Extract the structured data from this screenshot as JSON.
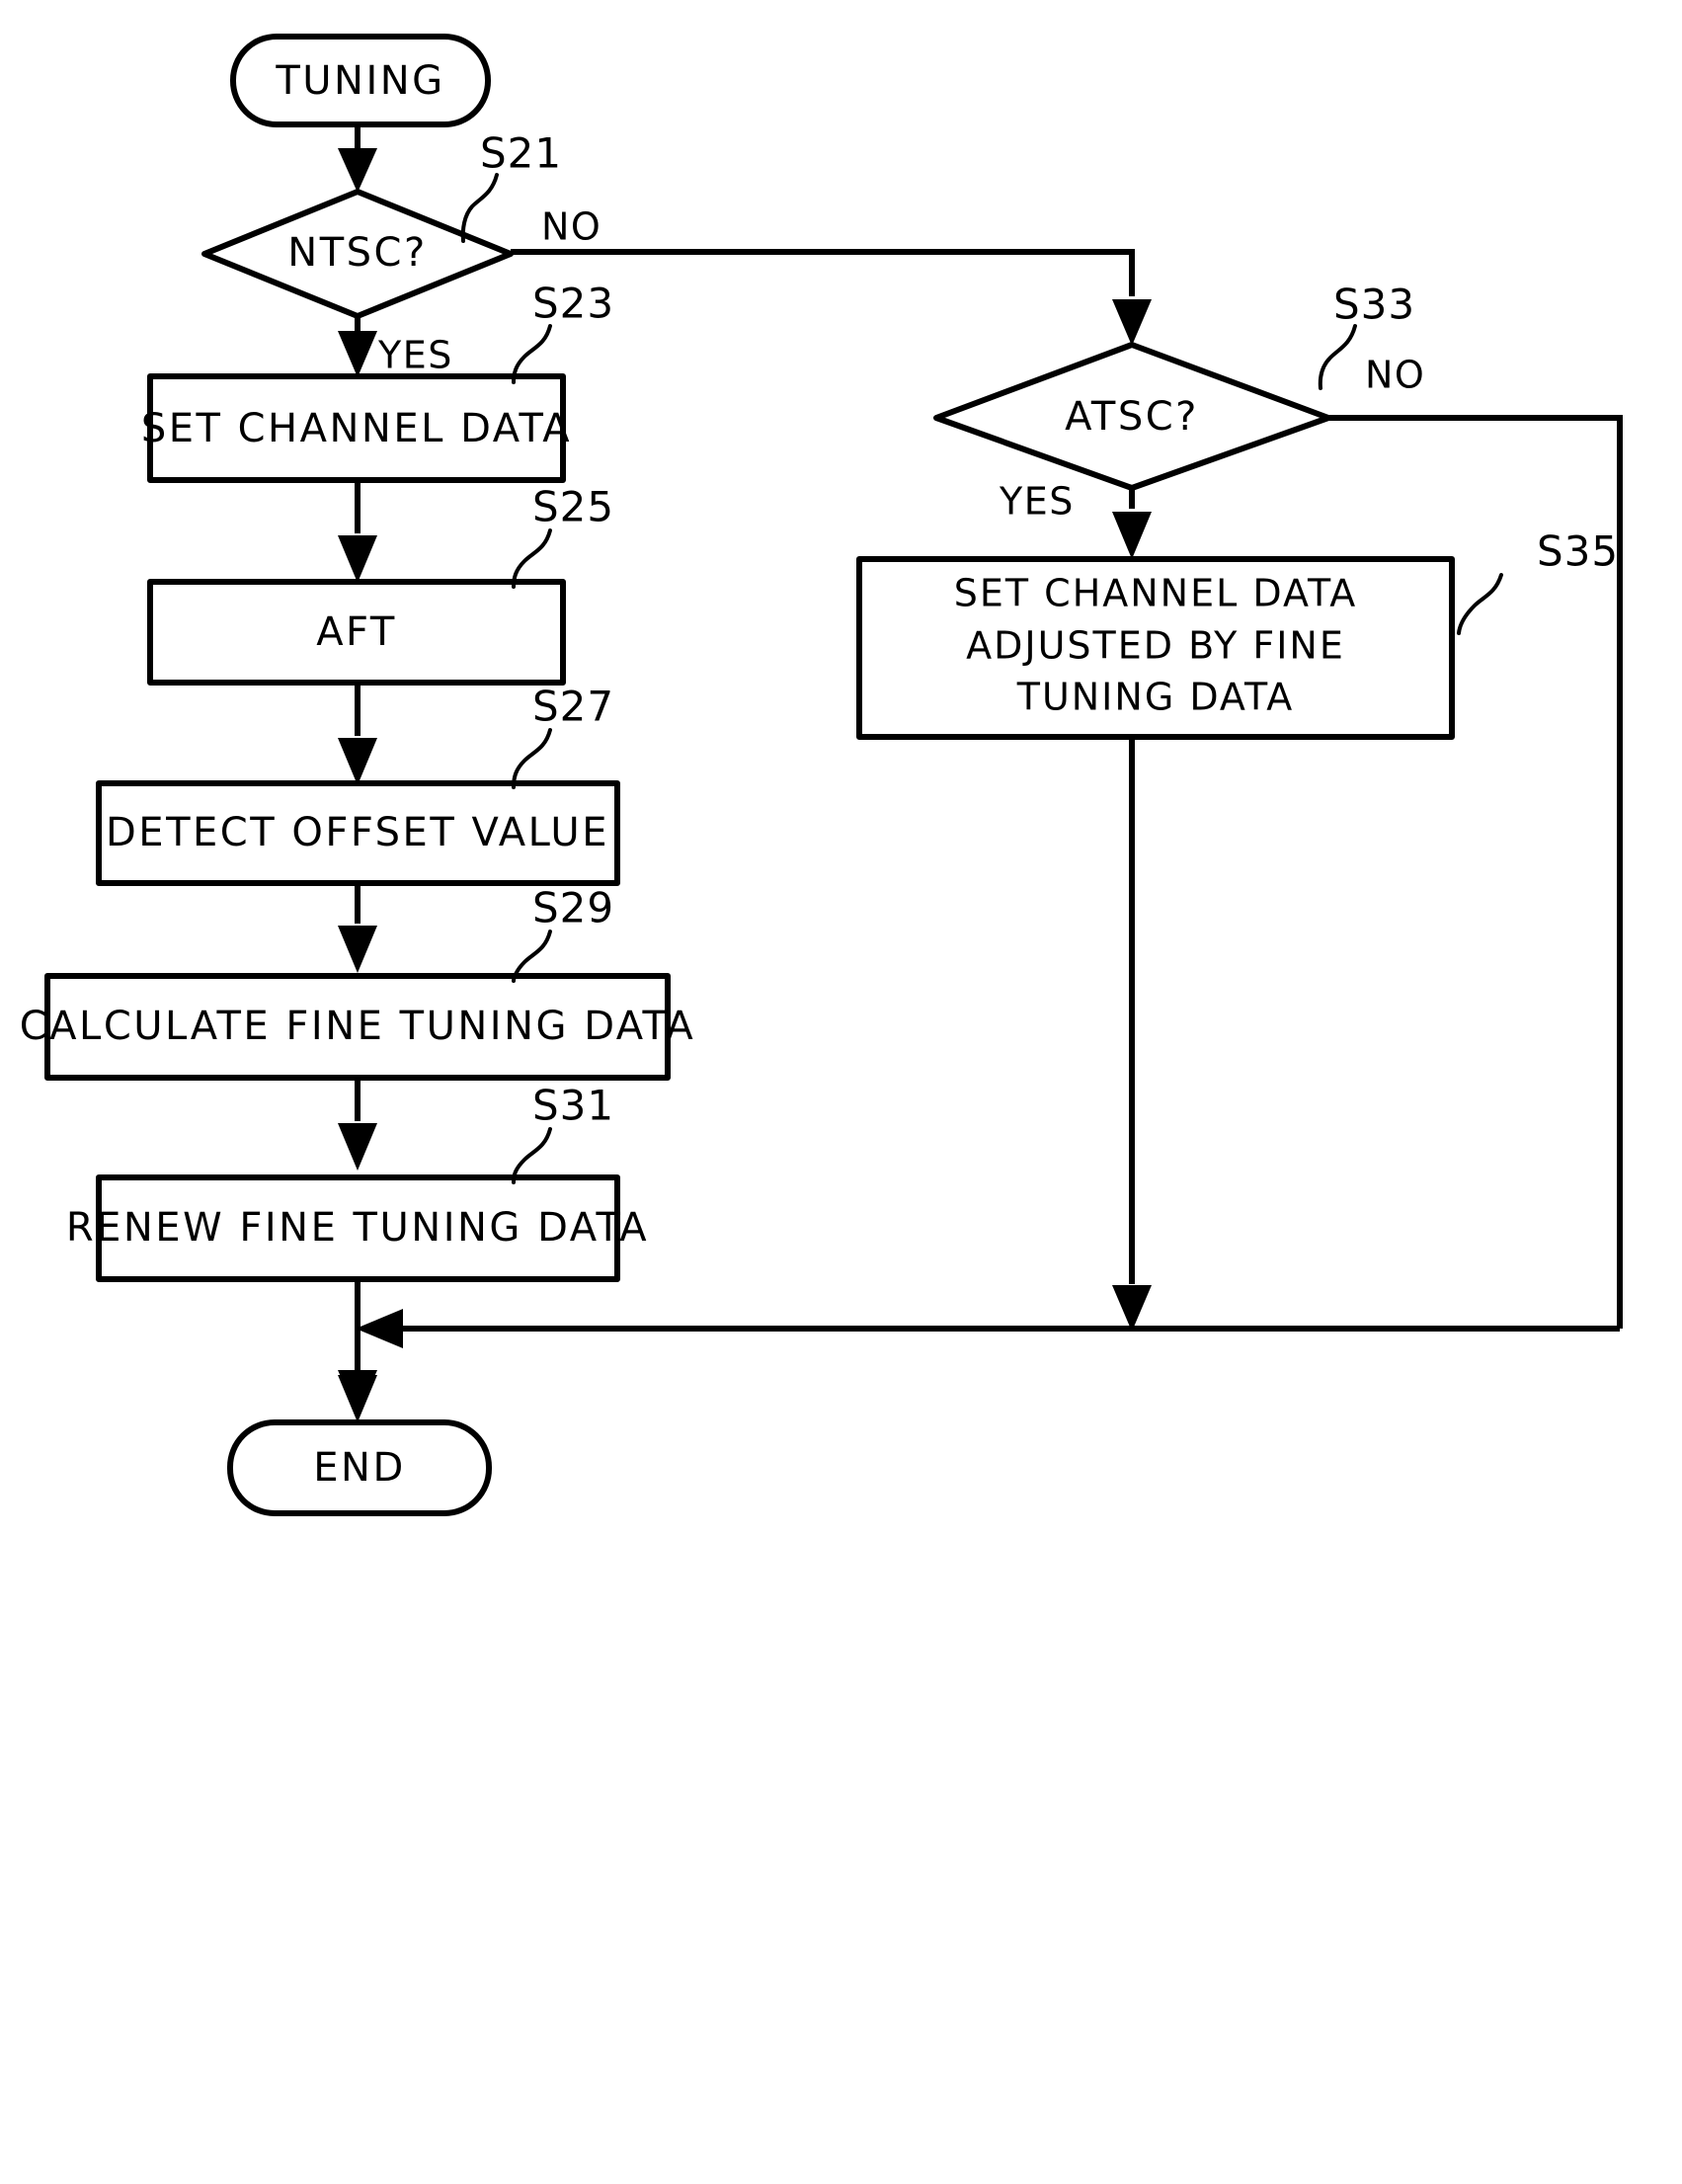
{
  "chart_data": {
    "type": "diagram",
    "title": "TUNING",
    "nodes": [
      {
        "id": "start",
        "shape": "terminator",
        "label": "TUNING"
      },
      {
        "id": "s21",
        "shape": "decision",
        "label": "NTSC?",
        "step": "S21"
      },
      {
        "id": "s23",
        "shape": "process",
        "label": "SET CHANNEL DATA",
        "step": "S23"
      },
      {
        "id": "s25",
        "shape": "process",
        "label": "AFT",
        "step": "S25"
      },
      {
        "id": "s27",
        "shape": "process",
        "label": "DETECT OFFSET VALUE",
        "step": "S27"
      },
      {
        "id": "s29",
        "shape": "process",
        "label": "CALCULATE FINE TUNING DATA",
        "step": "S29"
      },
      {
        "id": "s31",
        "shape": "process",
        "label": "RENEW FINE TUNING DATA",
        "step": "S31"
      },
      {
        "id": "s33",
        "shape": "decision",
        "label": "ATSC?",
        "step": "S33"
      },
      {
        "id": "s35",
        "shape": "process",
        "label_line1": "SET CHANNEL DATA",
        "label_line2": "ADJUSTED BY FINE",
        "label_line3": "TUNING DATA",
        "step": "S35"
      },
      {
        "id": "end",
        "shape": "terminator",
        "label": "END"
      }
    ],
    "edges": [
      {
        "from": "start",
        "to": "s21",
        "label": ""
      },
      {
        "from": "s21",
        "to": "s23",
        "label": "YES"
      },
      {
        "from": "s21",
        "to": "s33",
        "label": "NO"
      },
      {
        "from": "s23",
        "to": "s25",
        "label": ""
      },
      {
        "from": "s25",
        "to": "s27",
        "label": ""
      },
      {
        "from": "s27",
        "to": "s29",
        "label": ""
      },
      {
        "from": "s29",
        "to": "s31",
        "label": ""
      },
      {
        "from": "s31",
        "to": "end",
        "label": ""
      },
      {
        "from": "s33",
        "to": "s35",
        "label": "YES"
      },
      {
        "from": "s33",
        "to": "end",
        "label": "NO"
      },
      {
        "from": "s35",
        "to": "end",
        "label": ""
      }
    ]
  },
  "nodes": {
    "start": {
      "label": "TUNING"
    },
    "ntsc": {
      "label": "NTSC?",
      "step": "S21"
    },
    "set_channel_data": {
      "label": "SET CHANNEL DATA",
      "step": "S23"
    },
    "aft": {
      "label": "AFT",
      "step": "S25"
    },
    "detect_offset": {
      "label": "DETECT OFFSET VALUE",
      "step": "S27"
    },
    "calculate_fine": {
      "label": "CALCULATE FINE TUNING DATA",
      "step": "S29"
    },
    "renew_fine": {
      "label": "RENEW FINE TUNING DATA",
      "step": "S31"
    },
    "atsc": {
      "label": "ATSC?",
      "step": "S33"
    },
    "set_channel_adjusted": {
      "line1": "SET CHANNEL DATA",
      "line2": "ADJUSTED BY FINE",
      "line3": "TUNING DATA",
      "step": "S35"
    },
    "end": {
      "label": "END"
    }
  },
  "edge_labels": {
    "ntsc_no": "NO",
    "ntsc_yes": "YES",
    "atsc_no": "NO",
    "atsc_yes": "YES"
  },
  "colors": {
    "stroke": "#000000",
    "fill": "#ffffff",
    "background": "#ffffff"
  }
}
